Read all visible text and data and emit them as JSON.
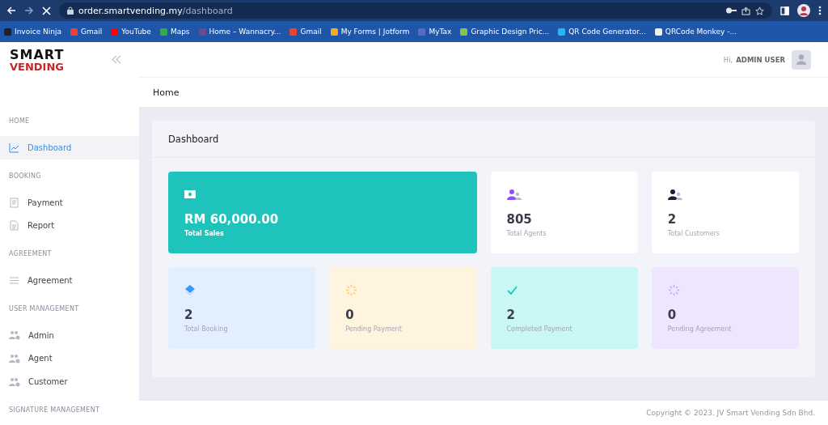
{
  "browser": {
    "url_host": "order.smartvending.my",
    "url_path": "/dashboard",
    "loading": true,
    "bookmarks": [
      {
        "label": "Invoice Ninja",
        "color": "#222222"
      },
      {
        "label": "Gmail",
        "color": "#ea4335"
      },
      {
        "label": "YouTube",
        "color": "#ff0000"
      },
      {
        "label": "Maps",
        "color": "#34a853"
      },
      {
        "label": "Home – Wannacry...",
        "color": "#6a4c93"
      },
      {
        "label": "Gmail",
        "color": "#ea4335"
      },
      {
        "label": "My Forms | Jotform",
        "color": "#f9a825"
      },
      {
        "label": "MyTax",
        "color": "#5c6bc0"
      },
      {
        "label": "Graphic Design Pric...",
        "color": "#8bc34a"
      },
      {
        "label": "QR Code Generator...",
        "color": "#29b6f6"
      },
      {
        "label": "QRCode Monkey -...",
        "color": "#eeeeee"
      }
    ]
  },
  "logo": {
    "line1": "SMART",
    "line2": "VENDING"
  },
  "sidebar": {
    "sections": [
      {
        "title": "HOME",
        "items": [
          {
            "label": "Dashboard",
            "kind": "chart",
            "selected": true
          }
        ]
      },
      {
        "title": "BOOKING",
        "items": [
          {
            "label": "Payment",
            "kind": "receipt",
            "selected": false
          },
          {
            "label": "Report",
            "kind": "document",
            "selected": false
          }
        ]
      },
      {
        "title": "AGREEMENT",
        "items": [
          {
            "label": "Agreement",
            "kind": "lines",
            "selected": false
          }
        ]
      },
      {
        "title": "USER MANAGEMENT",
        "items": [
          {
            "label": "Admin",
            "kind": "users",
            "selected": false
          },
          {
            "label": "Agent",
            "kind": "users",
            "selected": false
          },
          {
            "label": "Customer",
            "kind": "users",
            "selected": false
          }
        ]
      },
      {
        "title": "SIGNATURE MANAGEMENT"
      }
    ]
  },
  "header": {
    "greeting": "Hi,",
    "user": "ADMIN USER"
  },
  "breadcrumb": "Home",
  "panel": {
    "title": "Dashboard",
    "top_cards": [
      {
        "value": "RM 60,000.00",
        "label": "Total Sales",
        "kind": "cash",
        "color": "#1ec4bc",
        "wide": true
      },
      {
        "value": "805",
        "label": "Total Agents",
        "kind": "users-purple",
        "color": "#ffffff",
        "wide": false
      },
      {
        "value": "2",
        "label": "Total Customers",
        "kind": "users-dark",
        "color": "#ffffff",
        "wide": false
      }
    ],
    "bottom_cards": [
      {
        "value": "2",
        "label": "Total Booking",
        "kind": "layers",
        "color": "#e1efff"
      },
      {
        "value": "0",
        "label": "Pending Payment",
        "kind": "spinner-yellow",
        "color": "#fff4de"
      },
      {
        "value": "2",
        "label": "Completed Payment",
        "kind": "check",
        "color": "#c9f7f5"
      },
      {
        "value": "0",
        "label": "Pending Agreement",
        "kind": "spinner-purple",
        "color": "#eee5ff"
      }
    ]
  },
  "footer": "Copyright © 2023. JV Smart Vending Sdn Bhd."
}
